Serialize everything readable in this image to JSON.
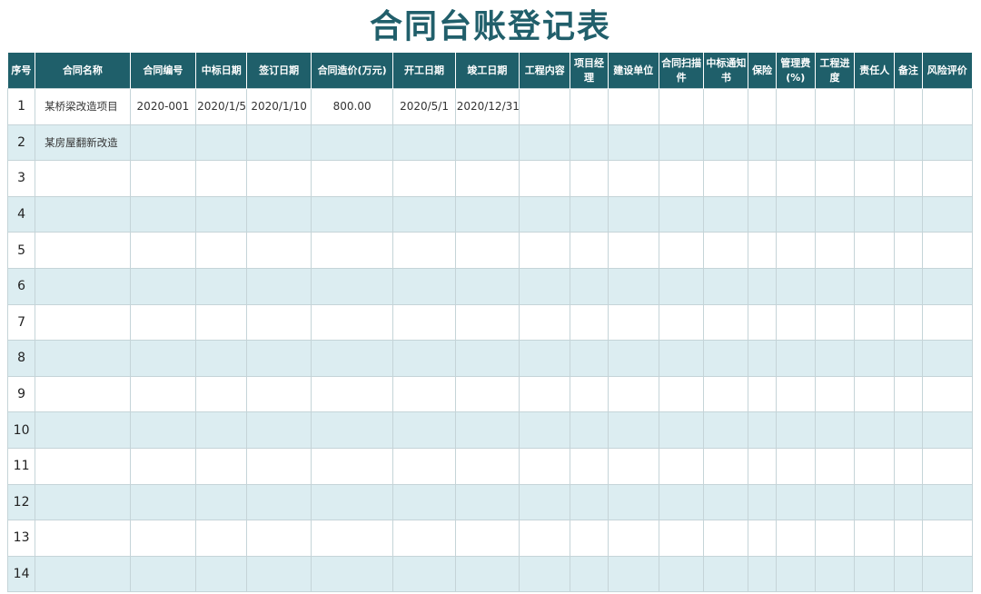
{
  "title": "合同台账登记表",
  "columns": [
    "序号",
    "合同名称",
    "合同编号",
    "中标日期",
    "签订日期",
    "合同造价(万元)",
    "开工日期",
    "竣工日期",
    "工程内容",
    "项目经理",
    "建设单位",
    "合同扫描件",
    "中标通知书",
    "保险",
    "管理费(%)",
    "工程进度",
    "责任人",
    "备注",
    "风险评价"
  ],
  "rows": [
    [
      "1",
      "某桥梁改造项目",
      "2020-001",
      "2020/1/5",
      "2020/1/10",
      "800.00",
      "2020/5/1",
      "2020/12/31",
      "",
      "",
      "",
      "",
      "",
      "",
      "",
      "",
      "",
      "",
      ""
    ],
    [
      "2",
      "某房屋翻新改造",
      "",
      "",
      "",
      "",
      "",
      "",
      "",
      "",
      "",
      "",
      "",
      "",
      "",
      "",
      "",
      "",
      ""
    ],
    [
      "3",
      "",
      "",
      "",
      "",
      "",
      "",
      "",
      "",
      "",
      "",
      "",
      "",
      "",
      "",
      "",
      "",
      "",
      ""
    ],
    [
      "4",
      "",
      "",
      "",
      "",
      "",
      "",
      "",
      "",
      "",
      "",
      "",
      "",
      "",
      "",
      "",
      "",
      "",
      ""
    ],
    [
      "5",
      "",
      "",
      "",
      "",
      "",
      "",
      "",
      "",
      "",
      "",
      "",
      "",
      "",
      "",
      "",
      "",
      "",
      ""
    ],
    [
      "6",
      "",
      "",
      "",
      "",
      "",
      "",
      "",
      "",
      "",
      "",
      "",
      "",
      "",
      "",
      "",
      "",
      "",
      ""
    ],
    [
      "7",
      "",
      "",
      "",
      "",
      "",
      "",
      "",
      "",
      "",
      "",
      "",
      "",
      "",
      "",
      "",
      "",
      "",
      ""
    ],
    [
      "8",
      "",
      "",
      "",
      "",
      "",
      "",
      "",
      "",
      "",
      "",
      "",
      "",
      "",
      "",
      "",
      "",
      "",
      ""
    ],
    [
      "9",
      "",
      "",
      "",
      "",
      "",
      "",
      "",
      "",
      "",
      "",
      "",
      "",
      "",
      "",
      "",
      "",
      "",
      ""
    ],
    [
      "10",
      "",
      "",
      "",
      "",
      "",
      "",
      "",
      "",
      "",
      "",
      "",
      "",
      "",
      "",
      "",
      "",
      "",
      ""
    ],
    [
      "11",
      "",
      "",
      "",
      "",
      "",
      "",
      "",
      "",
      "",
      "",
      "",
      "",
      "",
      "",
      "",
      "",
      "",
      ""
    ],
    [
      "12",
      "",
      "",
      "",
      "",
      "",
      "",
      "",
      "",
      "",
      "",
      "",
      "",
      "",
      "",
      "",
      "",
      "",
      ""
    ],
    [
      "13",
      "",
      "",
      "",
      "",
      "",
      "",
      "",
      "",
      "",
      "",
      "",
      "",
      "",
      "",
      "",
      "",
      "",
      ""
    ],
    [
      "14",
      "",
      "",
      "",
      "",
      "",
      "",
      "",
      "",
      "",
      "",
      "",
      "",
      "",
      "",
      "",
      "",
      "",
      ""
    ]
  ],
  "colors": {
    "header_bg": "#1f5f6a",
    "title": "#215f6b",
    "alt_row": "#dcedf1"
  }
}
